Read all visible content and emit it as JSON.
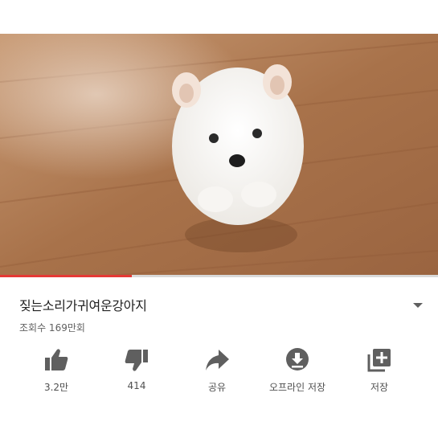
{
  "video": {
    "title": "짖는소리가귀여운강아지",
    "views": "조회수 169만회",
    "progress_fraction": 0.3
  },
  "actions": [
    {
      "label": "3.2만",
      "icon": "thumbs-up-icon"
    },
    {
      "label": "414",
      "icon": "thumbs-down-icon"
    },
    {
      "label": "공유",
      "icon": "share-icon"
    },
    {
      "label": "오프라인 저장",
      "icon": "download-icon"
    },
    {
      "label": "저장",
      "icon": "add-to-playlist-icon"
    }
  ],
  "colors": {
    "progress": "#e53935",
    "icon": "#5f5f5f"
  }
}
